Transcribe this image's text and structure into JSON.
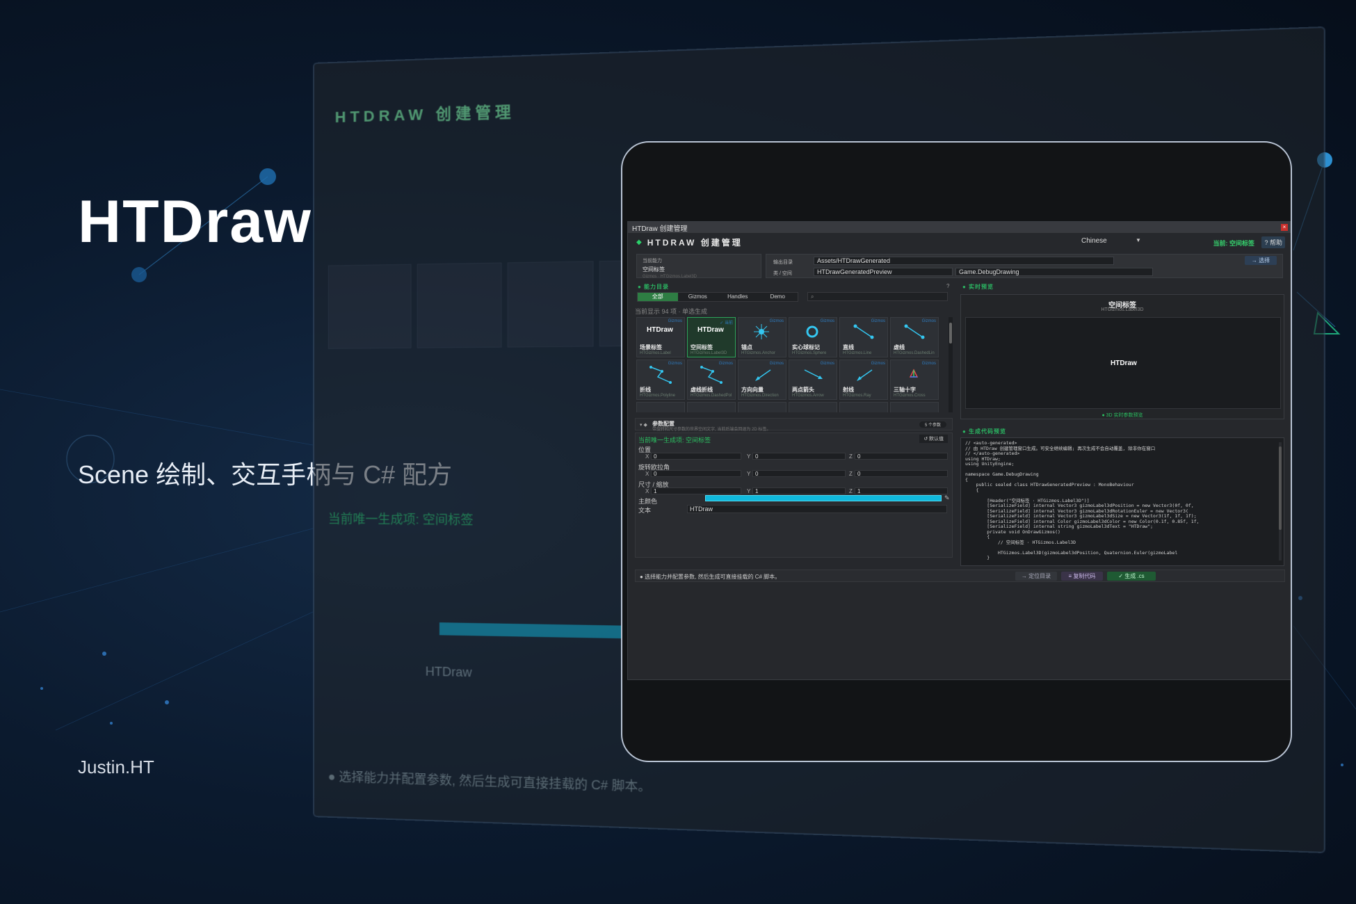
{
  "brand": {
    "title": "HTDraw",
    "subtitle": "Scene 绘制、交互手柄与 C# 配方",
    "author": "Justin.HT"
  },
  "ghost": {
    "title": "HTDRAW 创建管理",
    "current": "当前唯一生成项: 空间标签",
    "text_field": "HTDraw",
    "footer_hint": "● 选择能力并配置参数, 然后生成可直接挂载的 C# 脚本。"
  },
  "window": {
    "titlebar": "HTDraw 创建管理",
    "close_glyph": "×",
    "header_title": "HTDRAW 创建管理",
    "language": "Chinese",
    "current": "当前: 空间标签",
    "help": "? 帮助"
  },
  "capability": {
    "label": "当前能力",
    "name": "空间标签",
    "class": "Gizmos · HTGizmos.Label3D"
  },
  "output": {
    "dir_label": "输出目录",
    "dir_value": "Assets/HTDrawGenerated",
    "pick_button": "→ 选择",
    "class_ns_label": "类 / 空间",
    "class_value": "HTDrawGeneratedPreview",
    "namespace_value": "Game.DebugDrawing"
  },
  "catalog": {
    "section": "● 能力目录",
    "help": "?",
    "tabs": [
      "全部",
      "Gizmos",
      "Handles",
      "Demo"
    ],
    "search_icon": "⌕",
    "count": "当前显示 94 项 · 单选生成",
    "cards": [
      {
        "name": "场景标签",
        "cls": "HTGizmos.Label",
        "tag": "Gizmos",
        "kind": "logo"
      },
      {
        "name": "空间标签",
        "cls": "HTGizmos.Label3D",
        "tag": "✓ 当前",
        "kind": "logo",
        "selected": true
      },
      {
        "name": "锚点",
        "cls": "HTGizmos.Anchor",
        "tag": "Gizmos",
        "kind": "anchor"
      },
      {
        "name": "实心球标记",
        "cls": "HTGizmos.Sphere",
        "tag": "Gizmos",
        "kind": "sphere"
      },
      {
        "name": "直线",
        "cls": "HTGizmos.Line",
        "tag": "Gizmos",
        "kind": "line"
      },
      {
        "name": "虚线",
        "cls": "HTGizmos.DashedLin",
        "tag": "Gizmos",
        "kind": "line"
      },
      {
        "name": "折线",
        "cls": "HTGizmos.Polyline",
        "tag": "Gizmos",
        "kind": "poly"
      },
      {
        "name": "虚线折线",
        "cls": "HTGizmos.DashedPol",
        "tag": "Gizmos",
        "kind": "poly"
      },
      {
        "name": "方向向量",
        "cls": "HTGizmos.Direction",
        "tag": "Gizmos",
        "kind": "arrow"
      },
      {
        "name": "两点箭头",
        "cls": "HTGizmos.Arrow",
        "tag": "Gizmos",
        "kind": "arrow2"
      },
      {
        "name": "射线",
        "cls": "HTGizmos.Ray",
        "tag": "Gizmos",
        "kind": "arrow"
      },
      {
        "name": "三轴十字",
        "cls": "HTGizmos.Cross",
        "tag": "Gizmos",
        "kind": "cross"
      }
    ],
    "logo_text": "HTDraw"
  },
  "params": {
    "title": "参数配置",
    "desc": "带旋转和尺寸参数的世界空间文字, 当前后端会回退为 2D 标签。",
    "count": "5 个参数",
    "current": "当前唯一生成项: 空间标签",
    "default_btn": "↺ 默认值",
    "position_label": "位置",
    "rotation_label": "旋转欧拉角",
    "scale_label": "尺寸 / 缩放",
    "color_label": "主颜色",
    "text_label": "文本",
    "position": {
      "x": "0",
      "y": "0",
      "z": "0"
    },
    "rotation": {
      "x": "0",
      "y": "0",
      "z": "0"
    },
    "scale": {
      "x": "1",
      "y": "1",
      "z": "1"
    },
    "color": "#10b8dc",
    "text": "HTDraw",
    "axes": [
      "X",
      "Y",
      "Z"
    ]
  },
  "preview": {
    "section": "● 实时预览",
    "title": "空间标签",
    "sub": "HTGizmos.Label3D",
    "logo": "HTDraw",
    "hint": "● 3D 实时参数预览"
  },
  "code": {
    "section": "● 生成代码预览",
    "text": "// <auto-generated>\n// 由 HTDraw 创建管理窗口生成。可安全继续编辑; 再次生成不会自动覆盖, 除非你在窗口\n// </auto-generated>\nusing HTDraw;\nusing UnityEngine;\n\nnamespace Game.DebugDrawing\n{\n    public sealed class HTDrawGeneratedPreview : MonoBehaviour\n    {\n\n        [Header(\"空间标签 · HTGizmos.Label3D\")]\n        [SerializeField] internal Vector3 gizmoLabel3dPosition = new Vector3(0f, 0f,\n        [SerializeField] internal Vector3 gizmoLabel3dRotationEuler = new Vector3(\n        [SerializeField] internal Vector3 gizmoLabel3dSize = new Vector3(1f, 1f, 1f);\n        [SerializeField] internal Color gizmoLabel3dColor = new Color(0.1f, 0.85f, 1f,\n        [SerializeField] internal string gizmoLabel3dText = \"HTDraw\";\n        private void OnDrawGizmos()\n        {\n            // 空间标签 · HTGizmos.Label3D\n\n            HTGizmos.Label3D(gizmoLabel3dPosition, Quaternion.Euler(gizmoLabel\n        }"
  },
  "footer": {
    "hint": "● 选择能力并配置参数, 然后生成可直接挂载的 C# 脚本。",
    "locate": "→ 定位目录",
    "copy": "≡ 复制代码",
    "generate": "✓ 生成 .cs"
  },
  "colors": {
    "accent_green": "#2bc061",
    "accent_cyan": "#10b8dc",
    "gizmo_blue": "#2e7bbf"
  }
}
